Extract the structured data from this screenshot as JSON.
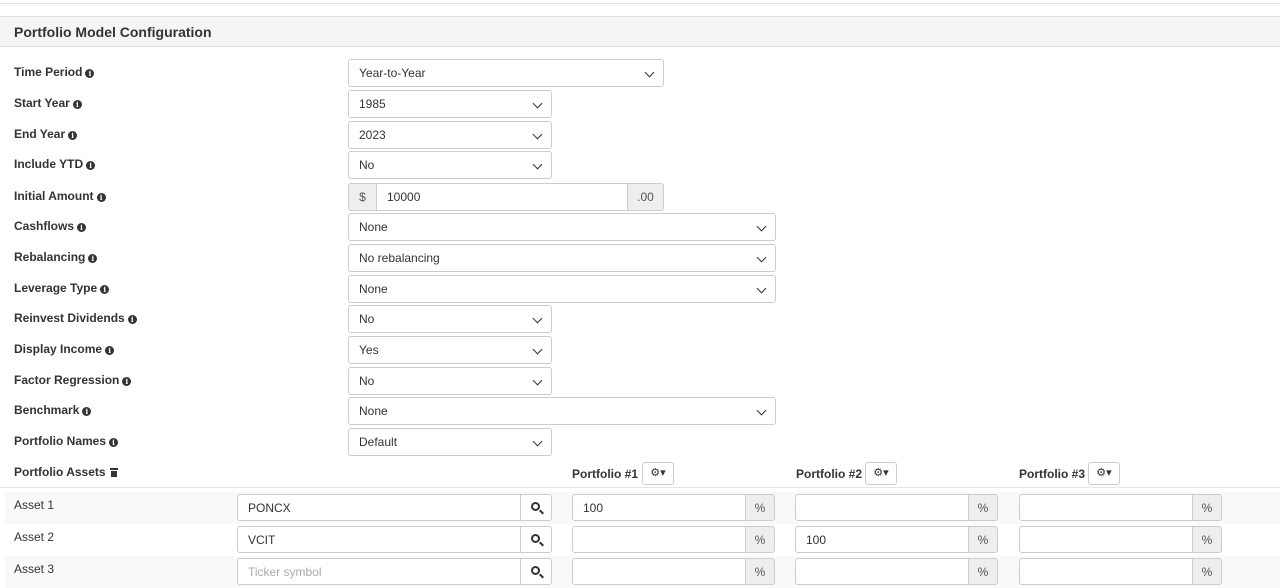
{
  "panel": {
    "title": "Portfolio Model Configuration"
  },
  "fields": {
    "time_period": {
      "label": "Time Period",
      "value": "Year-to-Year"
    },
    "start_year": {
      "label": "Start Year",
      "value": "1985"
    },
    "end_year": {
      "label": "End Year",
      "value": "2023"
    },
    "include_ytd": {
      "label": "Include YTD",
      "value": "No"
    },
    "initial_amount": {
      "label": "Initial Amount",
      "prefix": "$",
      "value": "10000",
      "suffix": ".00"
    },
    "cashflows": {
      "label": "Cashflows",
      "value": "None"
    },
    "rebalancing": {
      "label": "Rebalancing",
      "value": "No rebalancing"
    },
    "leverage_type": {
      "label": "Leverage Type",
      "value": "None"
    },
    "reinvest_dividends": {
      "label": "Reinvest Dividends",
      "value": "No"
    },
    "display_income": {
      "label": "Display Income",
      "value": "Yes"
    },
    "factor_regression": {
      "label": "Factor Regression",
      "value": "No"
    },
    "benchmark": {
      "label": "Benchmark",
      "value": "None"
    },
    "portfolio_names": {
      "label": "Portfolio Names",
      "value": "Default"
    }
  },
  "assets": {
    "label": "Portfolio Assets",
    "portfolios": [
      "Portfolio #1",
      "Portfolio #2",
      "Portfolio #3"
    ],
    "percent_symbol": "%",
    "rows": [
      {
        "name": "Asset 1",
        "ticker": "PONCX",
        "p1": "100",
        "p2": "",
        "p3": ""
      },
      {
        "name": "Asset 2",
        "ticker": "VCIT",
        "p1": "",
        "p2": "100",
        "p3": ""
      },
      {
        "name": "Asset 3",
        "ticker_placeholder": "Ticker symbol",
        "p1": "",
        "p2": "",
        "p3": ""
      }
    ]
  },
  "icons": {
    "info": "info-circle-icon",
    "gear": "gear-icon",
    "search": "search-icon",
    "trash": "trash-icon",
    "chevron": "chevron-down-icon"
  }
}
